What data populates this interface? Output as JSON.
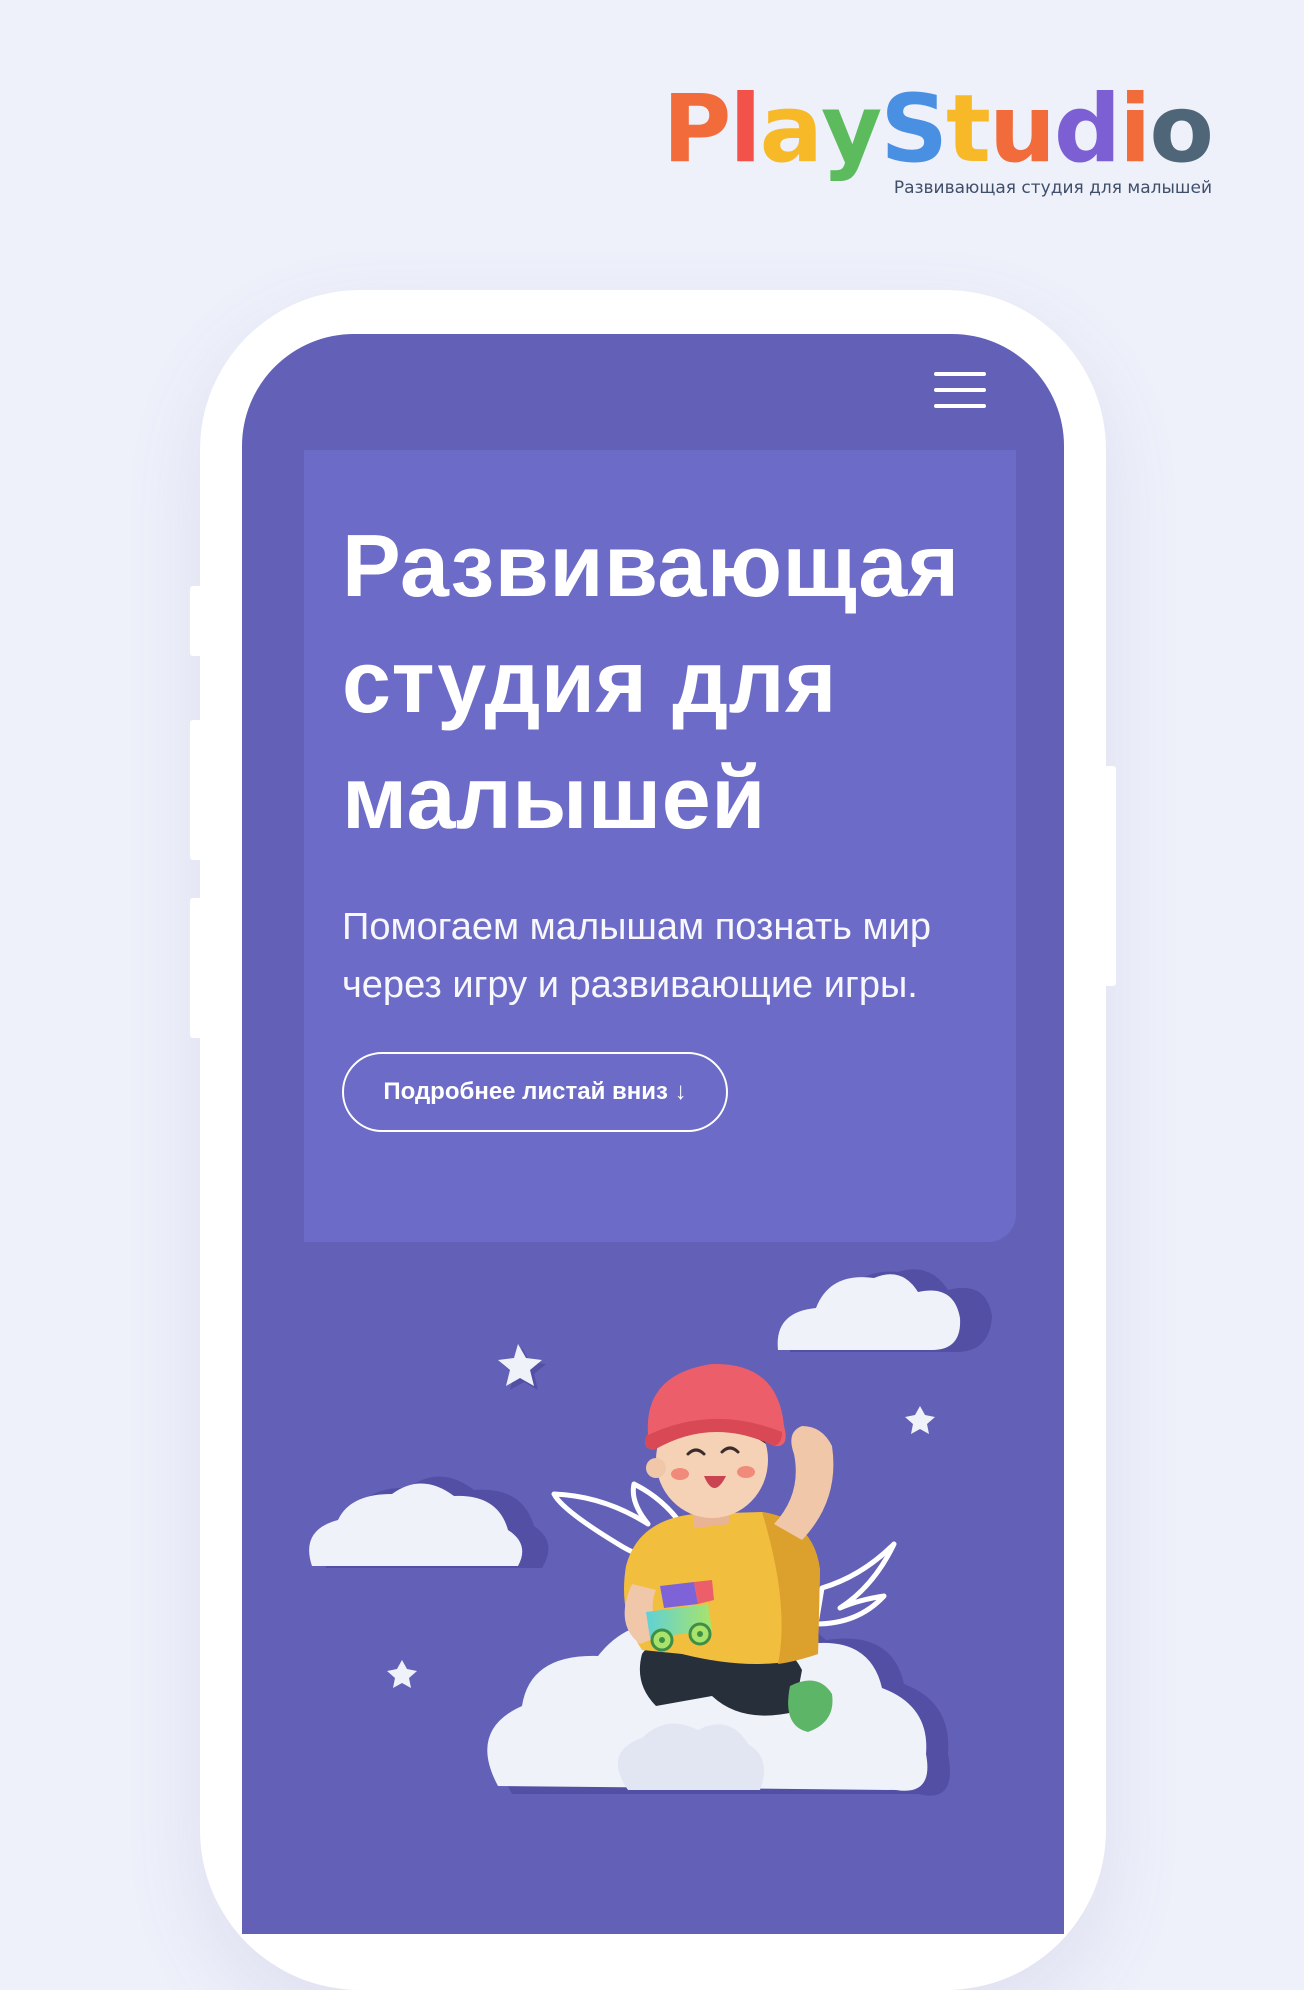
{
  "brand": {
    "logo_letters": [
      {
        "char": "P",
        "color": "#f26b3a"
      },
      {
        "char": "l",
        "color": "#f2524a"
      },
      {
        "char": "a",
        "color": "#f7b928"
      },
      {
        "char": "y",
        "color": "#5cbb5c"
      },
      {
        "char": "S",
        "color": "#4a90e2"
      },
      {
        "char": "t",
        "color": "#f7b928"
      },
      {
        "char": "u",
        "color": "#f26b3a"
      },
      {
        "char": "d",
        "color": "#7b5fd3"
      },
      {
        "char": "i",
        "color": "#f26b3a"
      },
      {
        "char": "o",
        "color": "#4f6679"
      }
    ],
    "tagline": "Развивающая студия для малышей"
  },
  "header": {
    "menu_icon": "hamburger-menu-icon"
  },
  "hero": {
    "title_lines": [
      "Развивающая",
      "студия для",
      "малышей"
    ],
    "subtitle_lines": [
      "Помогаем малышам познать мир",
      "через игру и развивающие игры."
    ],
    "cta_label": "Подробнее листай вниз ↓"
  },
  "colors": {
    "page_background": "#eef0fa",
    "screen_background": "#6361b7",
    "card_background": "#6c6bc7",
    "cloud": "#f0f2f9",
    "hat": "#ec5f6a",
    "shirt": "#f2be3d"
  },
  "illustration": {
    "name": "child-on-cloud-illustration",
    "elements": [
      "cloud",
      "cloud",
      "cloud",
      "star",
      "star",
      "star",
      "child-with-wings",
      "toy-car"
    ]
  }
}
